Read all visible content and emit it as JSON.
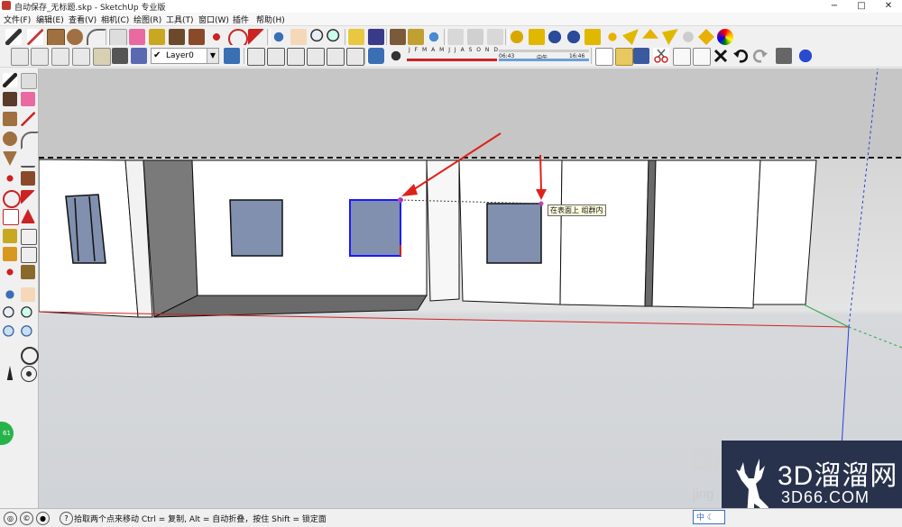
{
  "window": {
    "title": "自动保存_无标题.skp - SketchUp 专业版",
    "minimize": "−",
    "maximize": "□",
    "close": "✕"
  },
  "menu": [
    "文件(F)",
    "编辑(E)",
    "查看(V)",
    "相机(C)",
    "绘图(R)",
    "工具(T)",
    "窗口(W)",
    "插件",
    "帮助(H)"
  ],
  "layer": {
    "current": "Layer0",
    "check": "✔",
    "arrow": "▼"
  },
  "shadow_panel": {
    "months": "J F M A M J J A S O N D",
    "time_start": "06:43",
    "time_mid": "中午",
    "time_end": "16:46"
  },
  "tooltip": "在表面上  组群内",
  "status": {
    "message": "拾取两个点来移动 Ctrl = 复制, Alt = 自动折叠，按住 Shift = 锁定面",
    "badge": "61"
  },
  "ime": "中 ☾",
  "watermark": {
    "brand": "3D溜溜网",
    "url": "3D66.COM",
    "bai": "Ba",
    "jing": "jing"
  },
  "colors": {
    "selection": "#1a1aff",
    "window_fill": "#8090ae",
    "wall": "#ffffff",
    "red_axis": "#d42020",
    "green_axis": "#2ea84a",
    "blue_axis": "#2b3fd6",
    "arrow": "#e0201a",
    "inference_point": "#c040c0"
  }
}
